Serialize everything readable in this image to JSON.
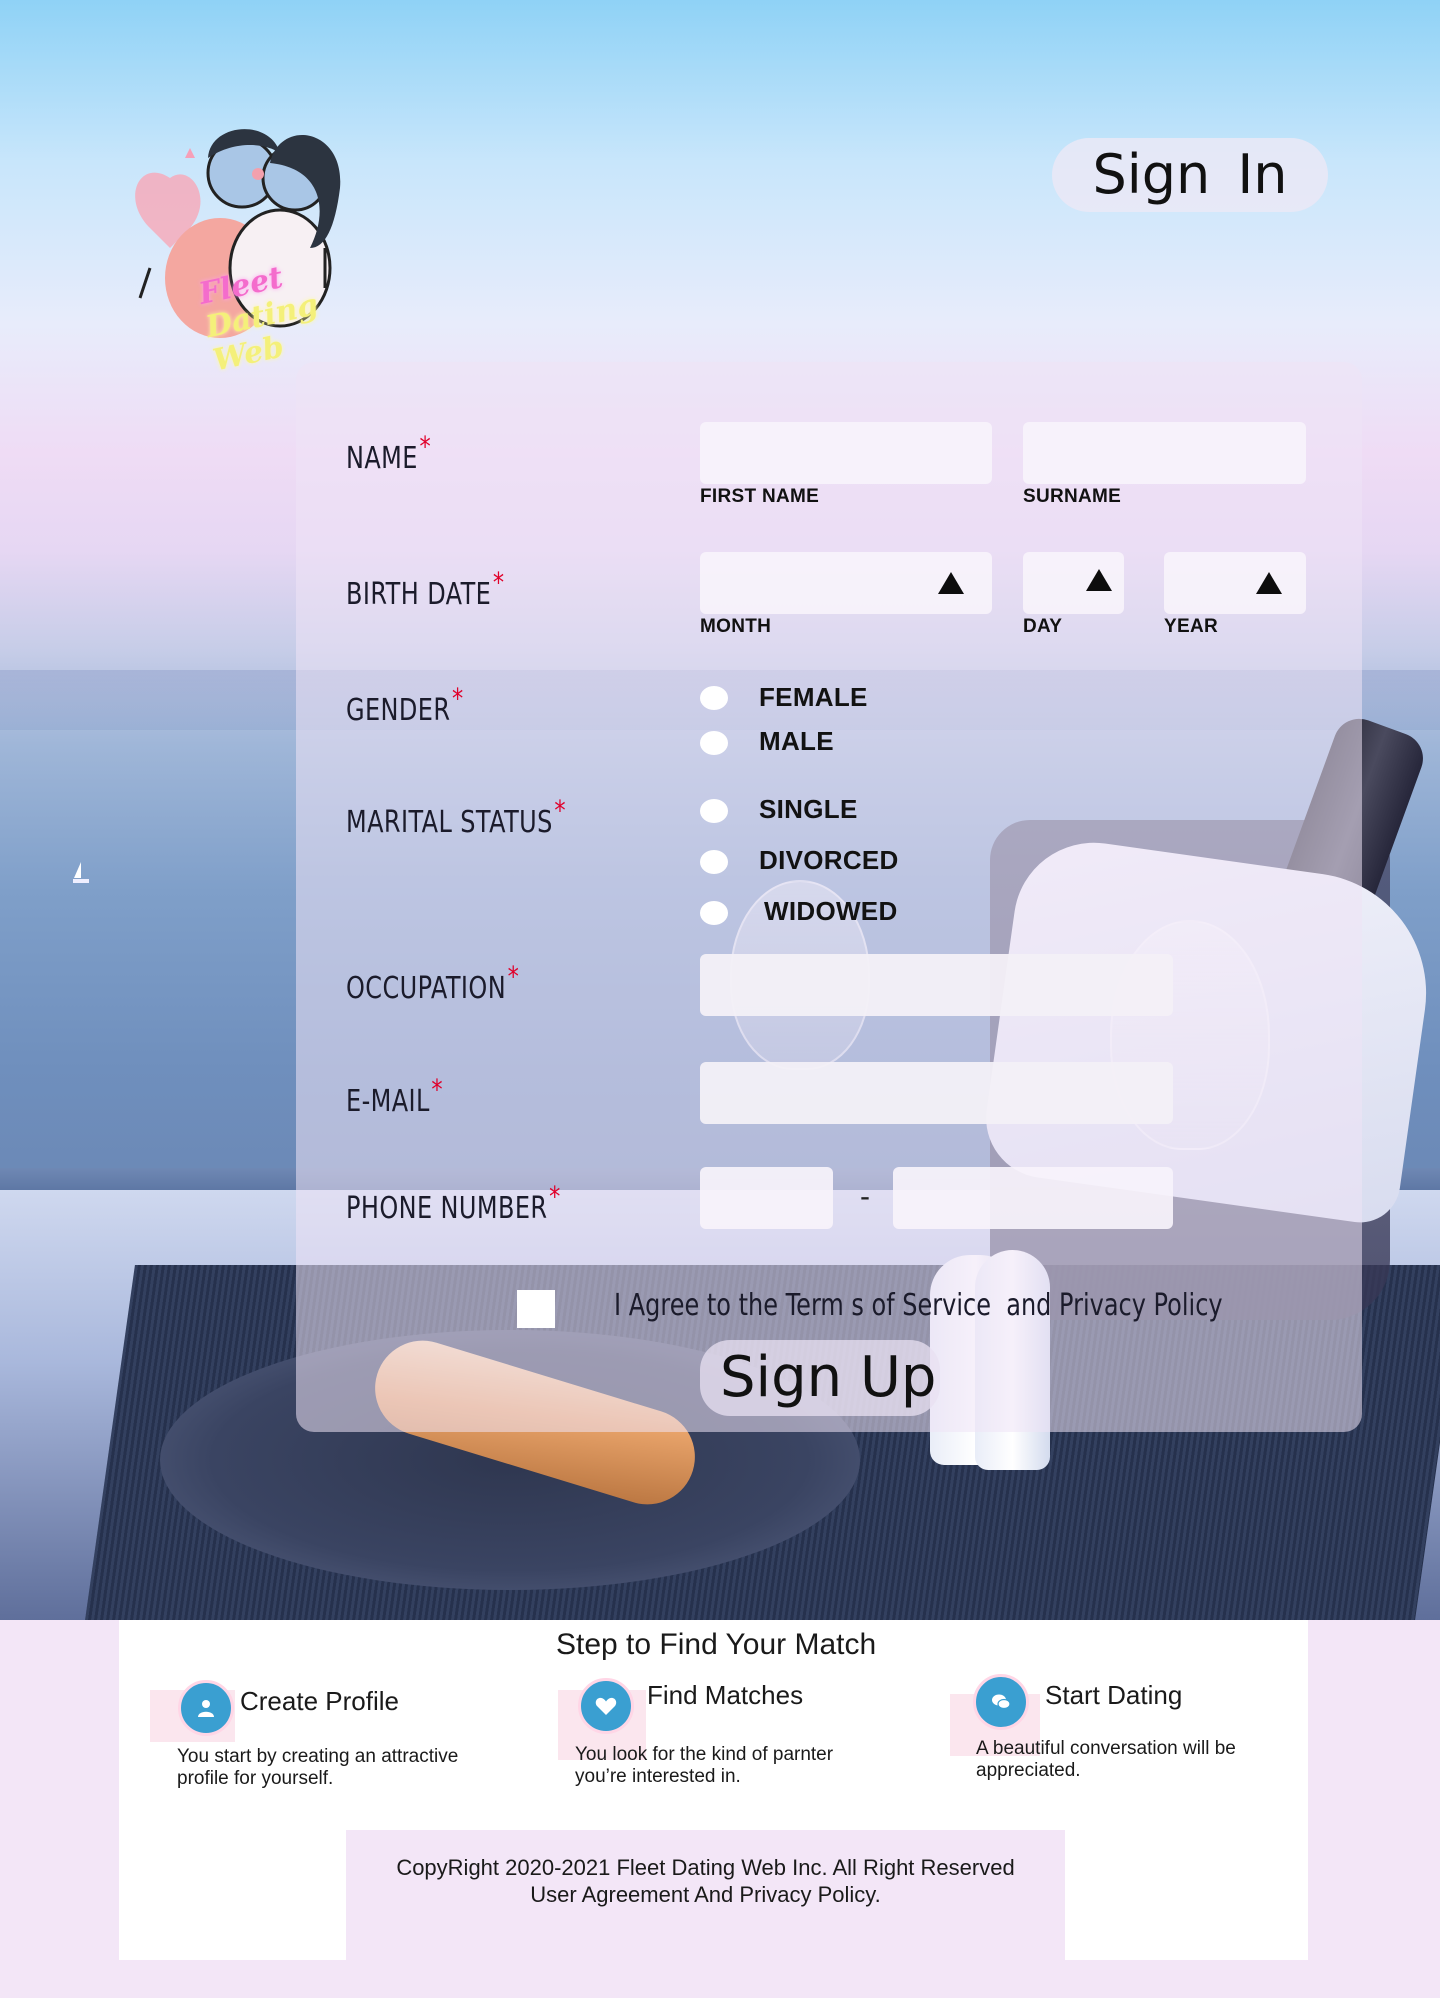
{
  "header": {
    "logo_lines": [
      "Fleet",
      "Dating",
      "Web"
    ],
    "sign_in_label": "Sign  In"
  },
  "form": {
    "name": {
      "label": "NAME",
      "first_sub": "FIRST NAME",
      "surname_sub": "SURNAME"
    },
    "birth_date": {
      "label": "BIRTH DATE",
      "month_sub": "MONTH",
      "day_sub": "DAY",
      "year_sub": "YEAR"
    },
    "gender": {
      "label": "GENDER",
      "options": [
        "FEMALE",
        "MALE"
      ]
    },
    "marital_status": {
      "label": "MARITAL STATUS",
      "options": [
        "SINGLE",
        "DIVORCED",
        "WIDOWED"
      ]
    },
    "occupation": {
      "label": "OCCUPATION"
    },
    "email": {
      "label": "E-MAIL"
    },
    "phone": {
      "label": "PHONE NUMBER",
      "separator": "-"
    },
    "required_mark": "*",
    "agree_text": "I Agree to the Term s of Service  and Privacy Policy",
    "sign_up_label": "Sign Up"
  },
  "steps": {
    "title": "Step to Find Your Match",
    "items": [
      {
        "title": "Create Profile",
        "desc": "You start by creating an attractive profile for yourself.",
        "icon": "user-icon"
      },
      {
        "title": "Find Matches",
        "desc": "You look for the kind of parnter you’re interested in.",
        "icon": "heart-icon"
      },
      {
        "title": "Start Dating",
        "desc": "A beautiful conversation will be appreciated.",
        "icon": "chat-icon"
      }
    ]
  },
  "footer": {
    "line1": "CopyRight 2020-2021 Fleet Dating Web Inc. All Right Reserved",
    "line2": "User Agreement And Privacy Policy."
  },
  "colors": {
    "required": "#e0002a",
    "step_icon": "#3a9fd1"
  }
}
